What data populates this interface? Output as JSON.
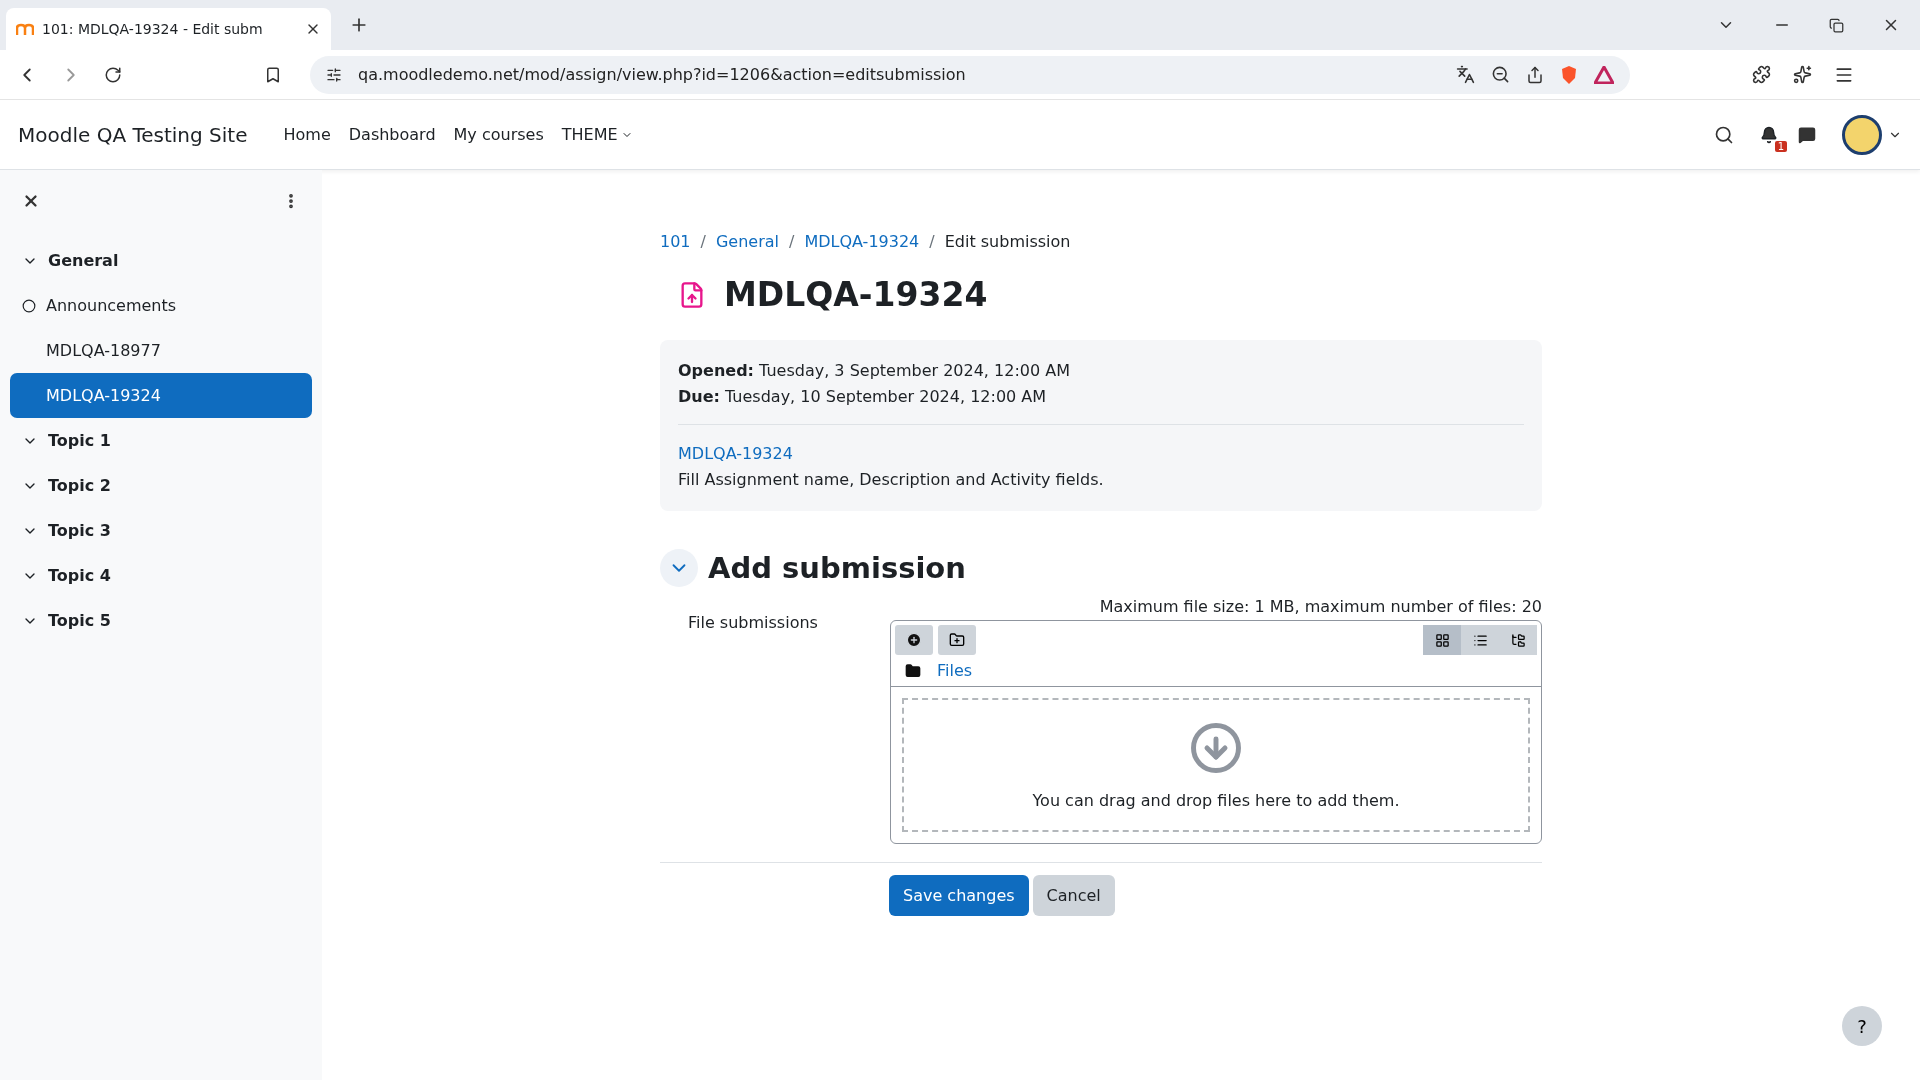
{
  "browser": {
    "tab_title": "101: MDLQA-19324 - Edit subm",
    "url": "qa.moodledemo.net/mod/assign/view.php?id=1206&action=editsubmission"
  },
  "navbar": {
    "site_name": "Moodle QA Testing Site",
    "links": [
      {
        "label": "Home",
        "dropdown": false
      },
      {
        "label": "Dashboard",
        "dropdown": false
      },
      {
        "label": "My courses",
        "dropdown": false
      },
      {
        "label": "THEME",
        "dropdown": true
      }
    ],
    "notification_count": "1"
  },
  "sidebar": {
    "items": [
      {
        "kind": "section",
        "label": "General",
        "expanded": true,
        "selected": false
      },
      {
        "kind": "activity",
        "label": "Announcements",
        "tracked": true,
        "selected": false
      },
      {
        "kind": "activity",
        "label": "MDLQA-18977",
        "tracked": false,
        "selected": false
      },
      {
        "kind": "activity",
        "label": "MDLQA-19324",
        "tracked": false,
        "selected": true
      },
      {
        "kind": "section",
        "label": "Topic 1",
        "expanded": true,
        "selected": false
      },
      {
        "kind": "section",
        "label": "Topic 2",
        "expanded": true,
        "selected": false
      },
      {
        "kind": "section",
        "label": "Topic 3",
        "expanded": true,
        "selected": false
      },
      {
        "kind": "section",
        "label": "Topic 4",
        "expanded": true,
        "selected": false
      },
      {
        "kind": "section",
        "label": "Topic 5",
        "expanded": true,
        "selected": false
      }
    ]
  },
  "breadcrumb": [
    {
      "kind": "link",
      "text": "101"
    },
    {
      "kind": "separator",
      "text": "/"
    },
    {
      "kind": "link",
      "text": "General"
    },
    {
      "kind": "separator",
      "text": "/"
    },
    {
      "kind": "link",
      "text": "MDLQA-19324"
    },
    {
      "kind": "separator",
      "text": "/"
    },
    {
      "kind": "current",
      "text": "Edit submission"
    }
  ],
  "page_title": "MDLQA-19324",
  "info": {
    "dates": [
      {
        "label": "Opened:",
        "value": "Tuesday, 3 September 2024, 12:00 AM"
      },
      {
        "label": "Due:",
        "value": "Tuesday, 10 September 2024, 12:00 AM"
      }
    ],
    "link": "MDLQA-19324",
    "description": "Fill Assignment name, Description and Activity fields."
  },
  "section": {
    "title": "Add submission",
    "expanded": true,
    "field_label": "File submissions",
    "limits": "Maximum file size: 1 MB, maximum number of files: 20",
    "folder": "Files",
    "view_modes": [
      {
        "kind": "grid",
        "selected": true
      },
      {
        "kind": "list",
        "selected": false
      },
      {
        "kind": "tree",
        "selected": false
      }
    ],
    "drop_text": "You can drag and drop files here to add them."
  },
  "buttons": [
    {
      "label": "Save changes",
      "kind": "primary"
    },
    {
      "label": "Cancel",
      "kind": "secondary"
    }
  ],
  "help": "?"
}
